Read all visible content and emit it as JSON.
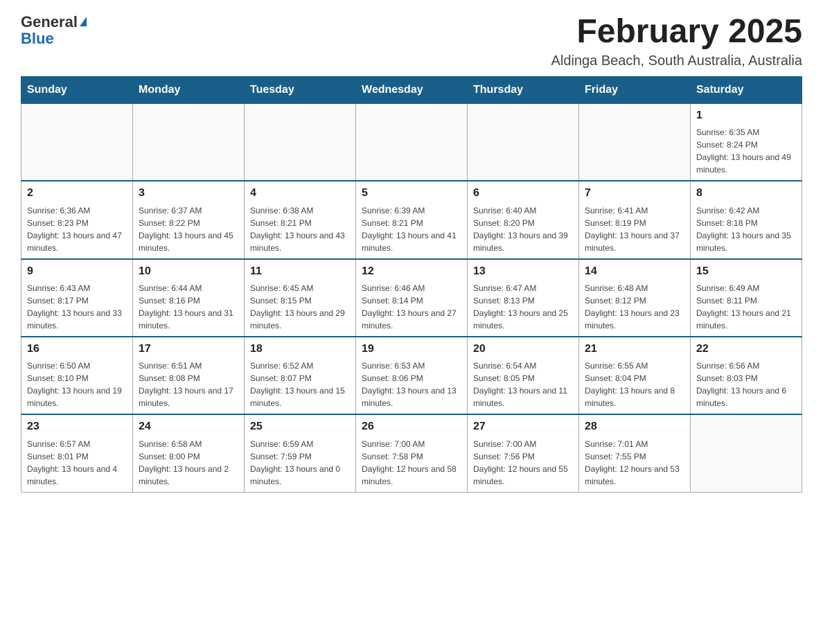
{
  "logo": {
    "general": "General",
    "blue": "Blue"
  },
  "title": "February 2025",
  "subtitle": "Aldinga Beach, South Australia, Australia",
  "days_of_week": [
    "Sunday",
    "Monday",
    "Tuesday",
    "Wednesday",
    "Thursday",
    "Friday",
    "Saturday"
  ],
  "weeks": [
    [
      {
        "day": "",
        "info": ""
      },
      {
        "day": "",
        "info": ""
      },
      {
        "day": "",
        "info": ""
      },
      {
        "day": "",
        "info": ""
      },
      {
        "day": "",
        "info": ""
      },
      {
        "day": "",
        "info": ""
      },
      {
        "day": "1",
        "info": "Sunrise: 6:35 AM\nSunset: 8:24 PM\nDaylight: 13 hours and 49 minutes."
      }
    ],
    [
      {
        "day": "2",
        "info": "Sunrise: 6:36 AM\nSunset: 8:23 PM\nDaylight: 13 hours and 47 minutes."
      },
      {
        "day": "3",
        "info": "Sunrise: 6:37 AM\nSunset: 8:22 PM\nDaylight: 13 hours and 45 minutes."
      },
      {
        "day": "4",
        "info": "Sunrise: 6:38 AM\nSunset: 8:21 PM\nDaylight: 13 hours and 43 minutes."
      },
      {
        "day": "5",
        "info": "Sunrise: 6:39 AM\nSunset: 8:21 PM\nDaylight: 13 hours and 41 minutes."
      },
      {
        "day": "6",
        "info": "Sunrise: 6:40 AM\nSunset: 8:20 PM\nDaylight: 13 hours and 39 minutes."
      },
      {
        "day": "7",
        "info": "Sunrise: 6:41 AM\nSunset: 8:19 PM\nDaylight: 13 hours and 37 minutes."
      },
      {
        "day": "8",
        "info": "Sunrise: 6:42 AM\nSunset: 8:18 PM\nDaylight: 13 hours and 35 minutes."
      }
    ],
    [
      {
        "day": "9",
        "info": "Sunrise: 6:43 AM\nSunset: 8:17 PM\nDaylight: 13 hours and 33 minutes."
      },
      {
        "day": "10",
        "info": "Sunrise: 6:44 AM\nSunset: 8:16 PM\nDaylight: 13 hours and 31 minutes."
      },
      {
        "day": "11",
        "info": "Sunrise: 6:45 AM\nSunset: 8:15 PM\nDaylight: 13 hours and 29 minutes."
      },
      {
        "day": "12",
        "info": "Sunrise: 6:46 AM\nSunset: 8:14 PM\nDaylight: 13 hours and 27 minutes."
      },
      {
        "day": "13",
        "info": "Sunrise: 6:47 AM\nSunset: 8:13 PM\nDaylight: 13 hours and 25 minutes."
      },
      {
        "day": "14",
        "info": "Sunrise: 6:48 AM\nSunset: 8:12 PM\nDaylight: 13 hours and 23 minutes."
      },
      {
        "day": "15",
        "info": "Sunrise: 6:49 AM\nSunset: 8:11 PM\nDaylight: 13 hours and 21 minutes."
      }
    ],
    [
      {
        "day": "16",
        "info": "Sunrise: 6:50 AM\nSunset: 8:10 PM\nDaylight: 13 hours and 19 minutes."
      },
      {
        "day": "17",
        "info": "Sunrise: 6:51 AM\nSunset: 8:08 PM\nDaylight: 13 hours and 17 minutes."
      },
      {
        "day": "18",
        "info": "Sunrise: 6:52 AM\nSunset: 8:07 PM\nDaylight: 13 hours and 15 minutes."
      },
      {
        "day": "19",
        "info": "Sunrise: 6:53 AM\nSunset: 8:06 PM\nDaylight: 13 hours and 13 minutes."
      },
      {
        "day": "20",
        "info": "Sunrise: 6:54 AM\nSunset: 8:05 PM\nDaylight: 13 hours and 11 minutes."
      },
      {
        "day": "21",
        "info": "Sunrise: 6:55 AM\nSunset: 8:04 PM\nDaylight: 13 hours and 8 minutes."
      },
      {
        "day": "22",
        "info": "Sunrise: 6:56 AM\nSunset: 8:03 PM\nDaylight: 13 hours and 6 minutes."
      }
    ],
    [
      {
        "day": "23",
        "info": "Sunrise: 6:57 AM\nSunset: 8:01 PM\nDaylight: 13 hours and 4 minutes."
      },
      {
        "day": "24",
        "info": "Sunrise: 6:58 AM\nSunset: 8:00 PM\nDaylight: 13 hours and 2 minutes."
      },
      {
        "day": "25",
        "info": "Sunrise: 6:59 AM\nSunset: 7:59 PM\nDaylight: 13 hours and 0 minutes."
      },
      {
        "day": "26",
        "info": "Sunrise: 7:00 AM\nSunset: 7:58 PM\nDaylight: 12 hours and 58 minutes."
      },
      {
        "day": "27",
        "info": "Sunrise: 7:00 AM\nSunset: 7:56 PM\nDaylight: 12 hours and 55 minutes."
      },
      {
        "day": "28",
        "info": "Sunrise: 7:01 AM\nSunset: 7:55 PM\nDaylight: 12 hours and 53 minutes."
      },
      {
        "day": "",
        "info": ""
      }
    ]
  ]
}
